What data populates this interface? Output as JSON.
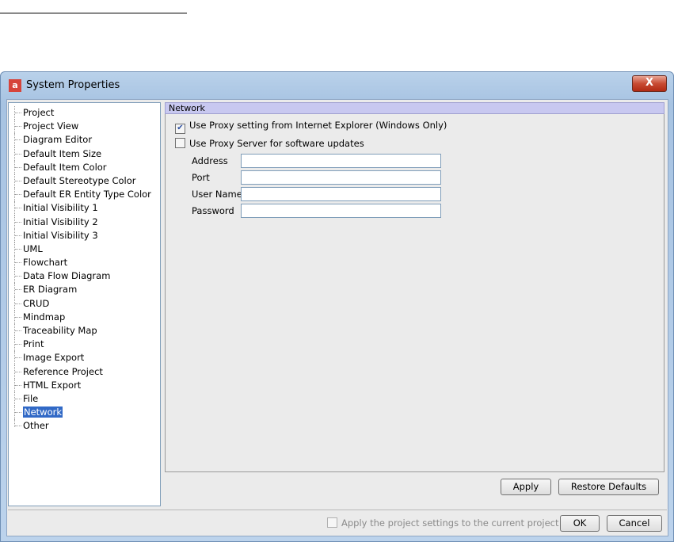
{
  "window": {
    "title": "System Properties",
    "close_glyph": "X",
    "app_icon": "a"
  },
  "tree": {
    "items": [
      "Project",
      "Project View",
      "Diagram Editor",
      "Default Item Size",
      "Default Item Color",
      "Default Stereotype Color",
      "Default ER Entity Type Color",
      "Initial Visibility 1",
      "Initial Visibility 2",
      "Initial Visibility 3",
      "UML",
      "Flowchart",
      "Data Flow Diagram",
      "ER Diagram",
      "CRUD",
      "Mindmap",
      "Traceability Map",
      "Print",
      "Image Export",
      "Reference Project",
      "HTML Export",
      "File",
      "Network",
      "Other"
    ],
    "selected": "Network"
  },
  "panel": {
    "header": "Network",
    "use_ie_proxy": {
      "label": "Use Proxy setting from Internet Explorer (Windows Only)",
      "checked": true
    },
    "use_proxy_server": {
      "label": "Use Proxy Server for software updates",
      "checked": false
    },
    "fields": {
      "address": {
        "label": "Address",
        "value": ""
      },
      "port": {
        "label": "Port",
        "value": ""
      },
      "user_name": {
        "label": "User Name",
        "value": ""
      },
      "password": {
        "label": "Password",
        "value": ""
      }
    },
    "apply_label": "Apply",
    "restore_label": "Restore Defaults"
  },
  "footer": {
    "apply_project_label": "Apply the project settings to the current project",
    "ok_label": "OK",
    "cancel_label": "Cancel"
  }
}
